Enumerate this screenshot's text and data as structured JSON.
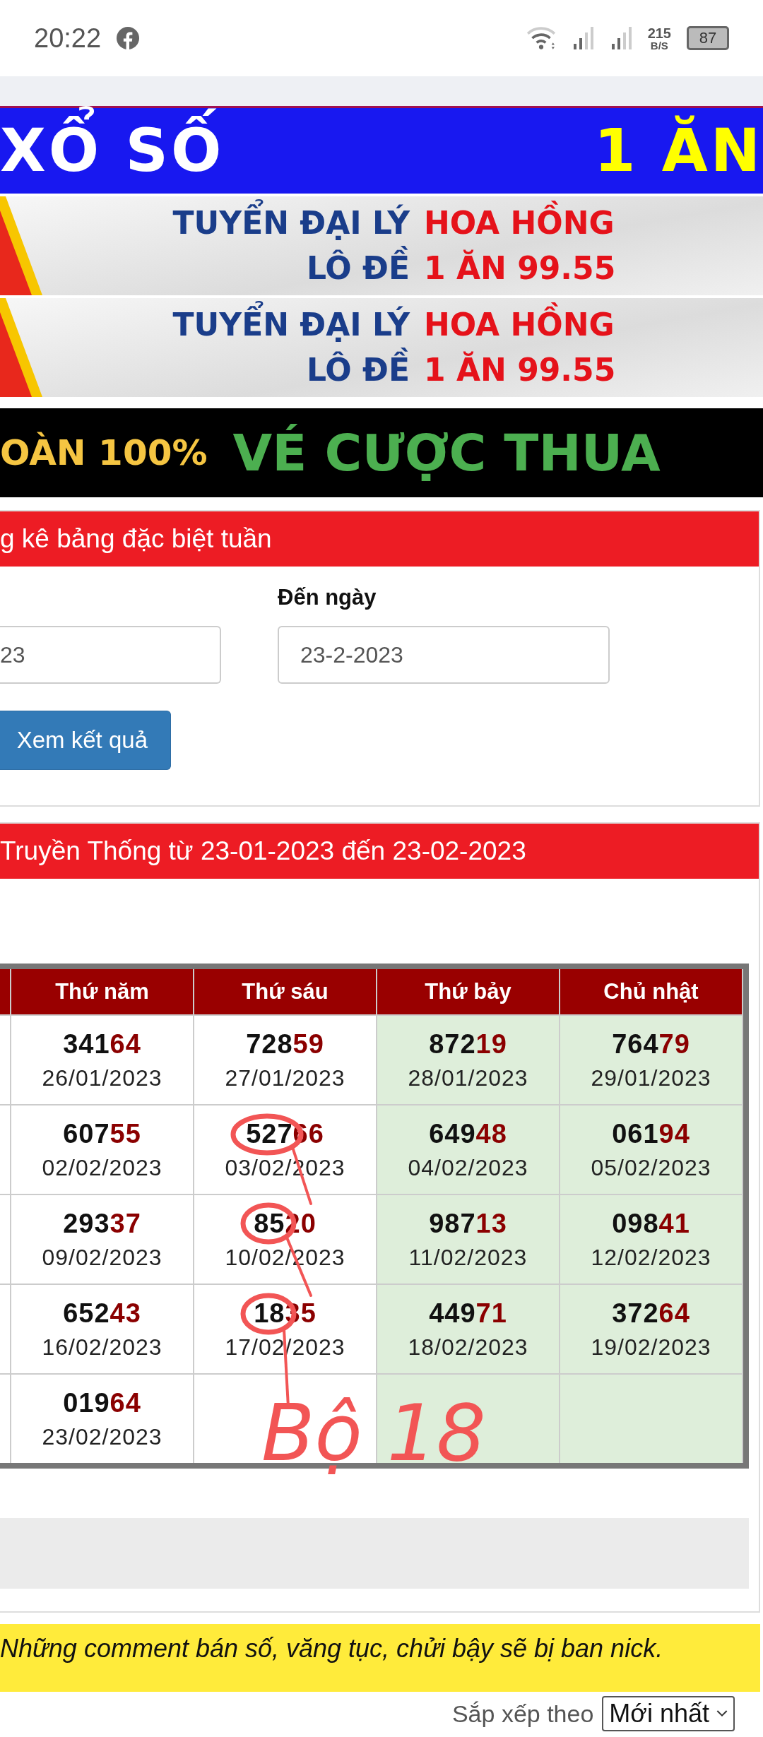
{
  "status_bar": {
    "time": "20:22",
    "speed": "215",
    "speed_unit": "B/S",
    "battery": "87"
  },
  "banners": [
    {
      "kind": "blue",
      "left": "XỔ SỐ",
      "right": "1 ĂN"
    },
    {
      "kind": "agent",
      "left_top": "TUYỂN ĐẠI LÝ",
      "left_bottom": "LÔ ĐỀ",
      "right_top": "HOA HỒNG",
      "right_bottom": "1 ĂN 99.55"
    },
    {
      "kind": "agent",
      "left_top": "TUYỂN ĐẠI LÝ",
      "left_bottom": "LÔ ĐỀ",
      "right_top": "HOA HỒNG",
      "right_bottom": "1 ĂN 99.55"
    },
    {
      "kind": "black",
      "left": "OÀN 100%",
      "right": "VÉ CƯỢC THUA"
    }
  ],
  "search_panel": {
    "title": "g kê bảng đặc biệt tuần",
    "from_value": "23",
    "to_label": "Đến ngày",
    "to_value": "23-2-2023",
    "button": "Xem kết quả"
  },
  "result_panel": {
    "title": "Truyền Thống từ 23-01-2023 đến 23-02-2023",
    "table": {
      "columns": [
        {
          "label": "Thứ năm",
          "weekend": false
        },
        {
          "label": "Thứ sáu",
          "weekend": false
        },
        {
          "label": "Thứ bảy",
          "weekend": true
        },
        {
          "label": "Chủ nhật",
          "weekend": true
        }
      ],
      "rows": [
        [
          {
            "head": "341",
            "tail": "64",
            "date": "26/01/2023"
          },
          {
            "head": "728",
            "tail": "59",
            "date": "27/01/2023"
          },
          {
            "head": "872",
            "tail": "19",
            "date": "28/01/2023"
          },
          {
            "head": "764",
            "tail": "79",
            "date": "29/01/2023"
          }
        ],
        [
          {
            "head": "607",
            "tail": "55",
            "date": "02/02/2023"
          },
          {
            "head": "527",
            "tail": "66",
            "date": "03/02/2023"
          },
          {
            "head": "649",
            "tail": "48",
            "date": "04/02/2023"
          },
          {
            "head": "061",
            "tail": "94",
            "date": "05/02/2023"
          }
        ],
        [
          {
            "head": "293",
            "tail": "37",
            "date": "09/02/2023"
          },
          {
            "head": "85",
            "tail": "20",
            "date": "10/02/2023"
          },
          {
            "head": "987",
            "tail": "13",
            "date": "11/02/2023"
          },
          {
            "head": "098",
            "tail": "41",
            "date": "12/02/2023"
          }
        ],
        [
          {
            "head": "652",
            "tail": "43",
            "date": "16/02/2023"
          },
          {
            "head": "18",
            "tail": "35",
            "date": "17/02/2023"
          },
          {
            "head": "449",
            "tail": "71",
            "date": "18/02/2023"
          },
          {
            "head": "372",
            "tail": "64",
            "date": "19/02/2023"
          }
        ],
        [
          {
            "head": "019",
            "tail": "64",
            "date": "23/02/2023"
          },
          {},
          {},
          {}
        ]
      ]
    }
  },
  "annotation": {
    "text": "Bộ 18"
  },
  "notice": "Những comment bán số, văng tục, chửi bậy sẽ bị ban nick.",
  "sort": {
    "label": "Sắp xếp theo",
    "value": "Mới nhất"
  }
}
